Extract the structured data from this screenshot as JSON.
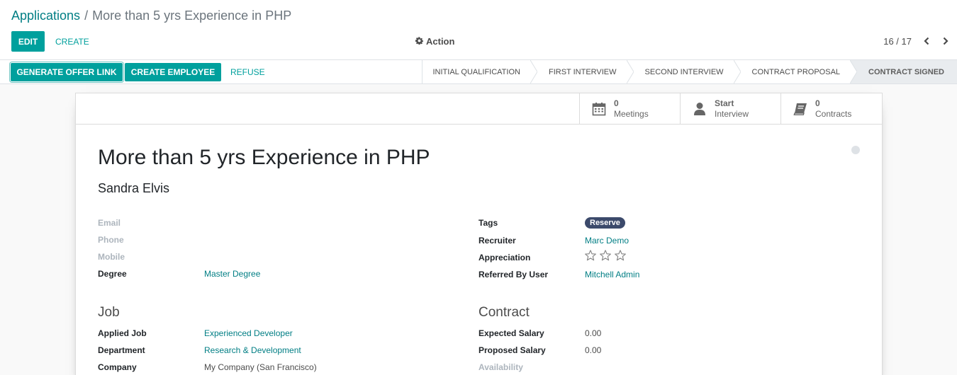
{
  "breadcrumb": {
    "parent": "Applications",
    "separator": "/",
    "current": "More than 5 yrs Experience in PHP"
  },
  "toolbar": {
    "edit_label": "EDIT",
    "create_label": "CREATE",
    "action_label": "Action"
  },
  "pager": {
    "value": "16 / 17"
  },
  "statusbar": {
    "generate_offer_label": "GENERATE OFFER LINK",
    "create_employee_label": "CREATE EMPLOYEE",
    "refuse_label": "REFUSE",
    "stages": [
      "INITIAL QUALIFICATION",
      "FIRST INTERVIEW",
      "SECOND INTERVIEW",
      "CONTRACT PROPOSAL",
      "CONTRACT SIGNED"
    ],
    "active_stage": "CONTRACT SIGNED"
  },
  "stats": {
    "meetings": {
      "value": "0",
      "label": "Meetings"
    },
    "interview": {
      "value": "Start",
      "label": "Interview"
    },
    "contracts": {
      "value": "0",
      "label": "Contracts"
    }
  },
  "record": {
    "title": "More than 5 yrs Experience in PHP",
    "applicant": "Sandra Elvis"
  },
  "left_fields": {
    "email_label": "Email",
    "email_value": "",
    "phone_label": "Phone",
    "phone_value": "",
    "mobile_label": "Mobile",
    "mobile_value": "",
    "degree_label": "Degree",
    "degree_value": "Master Degree"
  },
  "right_fields": {
    "tags_label": "Tags",
    "tag_value": "Reserve",
    "recruiter_label": "Recruiter",
    "recruiter_value": "Marc Demo",
    "appreciation_label": "Appreciation",
    "appreciation_stars": 0,
    "referred_label": "Referred By User",
    "referred_value": "Mitchell Admin"
  },
  "job": {
    "section_title": "Job",
    "applied_job_label": "Applied Job",
    "applied_job_value": "Experienced Developer",
    "department_label": "Department",
    "department_value": "Research & Development",
    "company_label": "Company",
    "company_value": "My Company (San Francisco)"
  },
  "contract": {
    "section_title": "Contract",
    "expected_label": "Expected Salary",
    "expected_value": "0.00",
    "proposed_label": "Proposed Salary",
    "proposed_value": "0.00",
    "availability_label": "Availability",
    "availability_value": ""
  },
  "colors": {
    "primary": "#00a09d",
    "link": "#017e84",
    "tag": "#3c4a6b"
  }
}
